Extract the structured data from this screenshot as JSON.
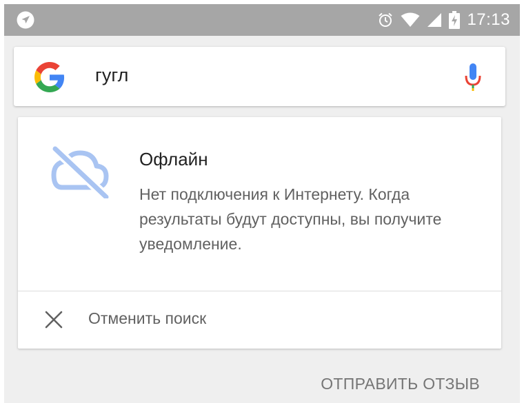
{
  "status_bar": {
    "time": "17:13",
    "icons": [
      "navigation-icon",
      "alarm-icon",
      "wifi-icon",
      "signal-icon",
      "battery-charging-icon"
    ]
  },
  "search": {
    "query": "гугл",
    "icons": [
      "google-logo",
      "mic-icon"
    ]
  },
  "offline_card": {
    "title": "Офлайн",
    "message": "Нет подключения к Интернету. Когда результаты будут доступны, вы получите уведомление.",
    "icon": "cloud-off-icon",
    "cancel_label": "Отменить поиск"
  },
  "footer": {
    "feedback_label": "ОТПРАВИТЬ ОТЗЫВ"
  },
  "colors": {
    "status_bar": "#a6a6a6",
    "background": "#efefef",
    "cloud_icon": "#a9c4f2",
    "google_blue": "#4285F4",
    "google_red": "#EA4335",
    "google_yellow": "#FBBC05",
    "google_green": "#34A853"
  }
}
